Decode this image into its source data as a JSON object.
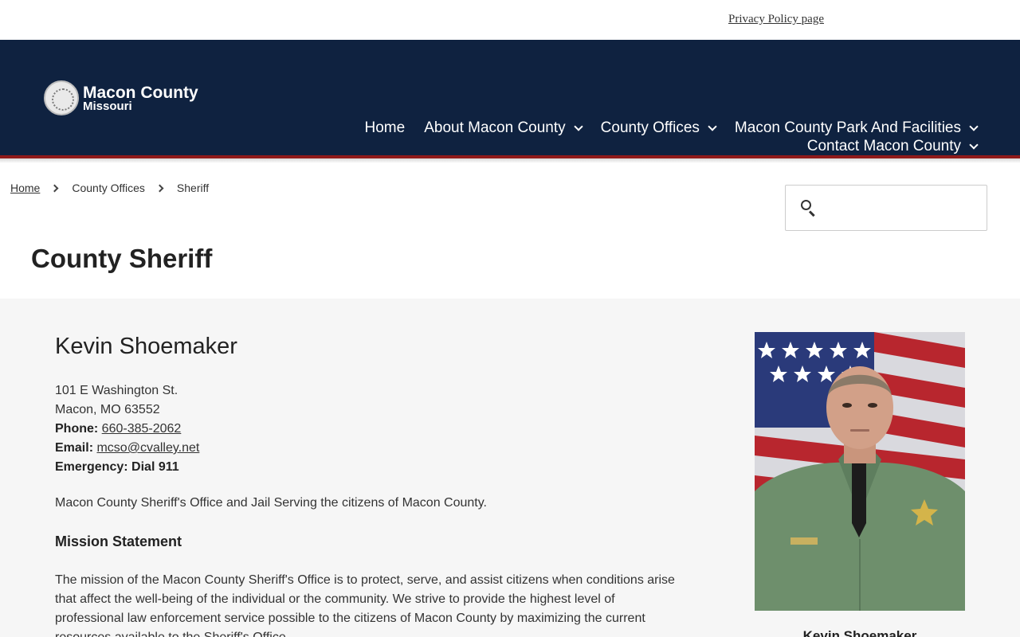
{
  "topbar": {
    "privacy_link": "Privacy Policy page"
  },
  "logo": {
    "name": "Macon County",
    "subtitle": "Missouri"
  },
  "nav": {
    "items": [
      {
        "label": "Home"
      },
      {
        "label": "About Macon County"
      },
      {
        "label": "County Offices"
      },
      {
        "label": "Macon County Park And Facilities"
      },
      {
        "label": "Contact Macon County"
      }
    ]
  },
  "breadcrumb": {
    "items": [
      "Home",
      "County Offices",
      "Sheriff"
    ]
  },
  "search": {
    "placeholder": ""
  },
  "page": {
    "title": "County Sheriff"
  },
  "sheriff": {
    "name": "Kevin Shoemaker",
    "address_line1": "101 E Washington St.",
    "address_line2": "Macon, MO 63552",
    "phone_label": "Phone:",
    "phone": "660-385-2062",
    "email_label": "Email:",
    "email": "mcso@cvalley.net",
    "emergency": "Emergency: Dial 911",
    "tagline": "Macon County Sheriff's Office and Jail Serving the citizens of Macon County.",
    "mission_heading": "Mission Statement",
    "mission_text": "The mission of the Macon County Sheriff's Office is to protect, serve, and assist citizens when conditions arise that affect the well-being of the individual or the community. We strive to provide the highest level of professional law enforcement service possible to the citizens of Macon County by maximizing the current resources available to the Sheriff's Office.",
    "photo_caption": "Kevin Shoemaker"
  },
  "colors": {
    "header_bg": "#0f2240",
    "header_accent": "#8f1a1a",
    "content_bg": "#f6f6f6"
  }
}
